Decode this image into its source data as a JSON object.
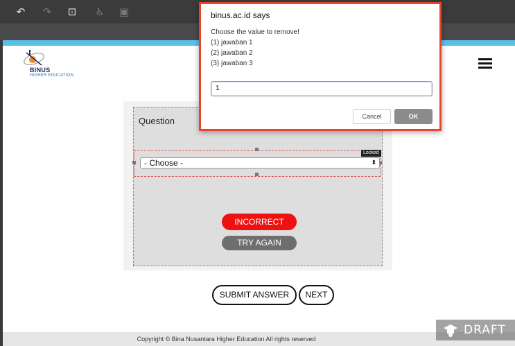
{
  "toolbar": {
    "buttons": [
      {
        "icon": "undo-icon",
        "glyph": "↶",
        "enabled": true
      },
      {
        "icon": "redo-icon",
        "glyph": "↷",
        "enabled": false
      },
      {
        "icon": "select-frame-icon",
        "glyph": "⊡",
        "enabled": true
      },
      {
        "icon": "accessibility-icon",
        "glyph": "♿",
        "enabled": false
      },
      {
        "icon": "screen-icon",
        "glyph": "▣",
        "enabled": false
      }
    ]
  },
  "header": {
    "brand": "BINUS",
    "brand_sub": "HIGHER EDUCATION",
    "accent_color": "#5bc0e8"
  },
  "question": {
    "label": "Question",
    "dropdown_value": "- Choose -",
    "locked_tag": "Locked"
  },
  "feedback": {
    "incorrect_label": "INCORRECT",
    "try_again_label": "TRY AGAIN",
    "incorrect_color": "#ee1111"
  },
  "actions": {
    "submit_label": "SUBMIT ANSWER",
    "next_label": "NEXT"
  },
  "footer": {
    "copyright": "Copyright © Bina Nusantara Higher Education All rights reserved",
    "draft_label": "DRAFT"
  },
  "dialog": {
    "title": "binus.ac.id says",
    "message_lines": [
      "Choose the value to remove!",
      "(1) jawaban 1",
      "(2) jawaban 2",
      "(3) jawaban 3"
    ],
    "input_value": "1",
    "cancel_label": "Cancel",
    "ok_label": "OK",
    "highlight_color": "#e8442a"
  }
}
